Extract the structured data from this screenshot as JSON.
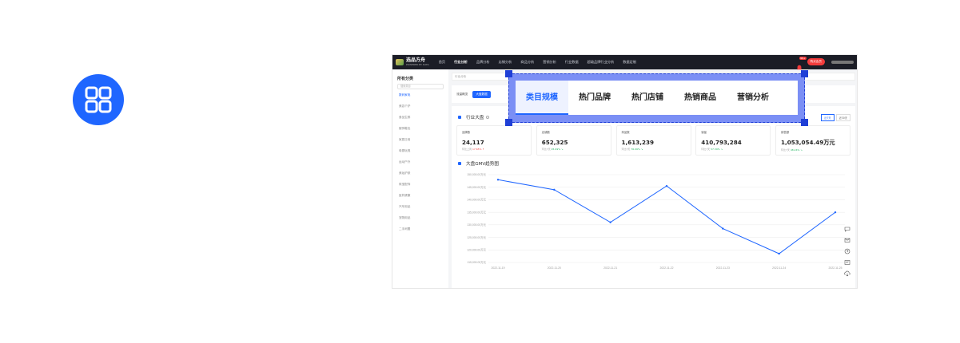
{
  "app": {
    "logo_title": "选品方舟",
    "logo_sub": "POWERED BY DATA"
  },
  "nav": {
    "items": [
      "首页",
      "行业分析",
      "品牌分析",
      "店铺分析",
      "商品分析",
      "营销分析",
      "行业数据",
      "超级品牌行业分析",
      "数据定制"
    ],
    "active_index": 1
  },
  "header": {
    "badge": "99+",
    "cta_label": "购买会员"
  },
  "sidebar": {
    "title": "所有分类",
    "search_placeholder": "搜索类目",
    "items": [
      "数码家电",
      "美容个护",
      "食品生鲜",
      "服饰鞋包",
      "家居日用",
      "母婴玩具",
      "运动户外",
      "美妆护肤",
      "珠宝配饰",
      "医药健康",
      "汽车用品",
      "宠物用品",
      "二手闲置"
    ]
  },
  "content": {
    "breadcrumb": "行业分析",
    "tabs": [
      "流量概览",
      "大盘数据"
    ],
    "active_tab": 1
  },
  "overlay_tabs": {
    "items": [
      "类目规模",
      "热门品牌",
      "热门店铺",
      "热销商品",
      "营销分析"
    ],
    "active_index": 0
  },
  "section_industry": {
    "title": "行业大盘",
    "ranges": [
      "近7天",
      "近30天"
    ]
  },
  "metrics": [
    {
      "label": "品牌数",
      "value": "24,117",
      "delta_prefix": "环比上周",
      "delta": "17.65%",
      "dir": "up"
    },
    {
      "label": "店铺数",
      "value": "652,325",
      "delta_prefix": "环比7天",
      "delta": "45.99%",
      "dir": "down"
    },
    {
      "label": "商品数",
      "value": "1,613,239",
      "delta_prefix": "环比7天",
      "delta": "76.06%",
      "dir": "down"
    },
    {
      "label": "销量",
      "value": "410,793,284",
      "delta_prefix": "环比7天",
      "delta": "57.39%",
      "dir": "down"
    },
    {
      "label": "销售额",
      "value": "1,053,054.49万元",
      "delta_prefix": "环比7天",
      "delta": "48.24%",
      "dir": "down"
    }
  ],
  "section_chart": {
    "title": "大盘GMV趋势图"
  },
  "colors": {
    "accent": "#1f66ff",
    "overlay": "#7b8ff5",
    "topbar": "#1b1d26",
    "danger": "#f23c3c"
  },
  "chart_data": {
    "type": "line",
    "title": "大盘GMV趋势图",
    "x": [
      "2022-11-19",
      "2022-11-20",
      "2022-11-21",
      "2022-11-22",
      "2022-11-23",
      "2022-11-24",
      "2022-11-25"
    ],
    "y_ticks": [
      "150,000.00万元",
      "145,000.00万元",
      "140,000.00万元",
      "135,000.00万元",
      "130,000.00万元",
      "125,000.00万元",
      "120,000.00万元",
      "115,000.00万元"
    ],
    "ylim": [
      115000,
      150000
    ],
    "series": [
      {
        "values": [
          148000,
          144000,
          131000,
          145500,
          128500,
          118500,
          135000
        ]
      }
    ],
    "grid": true
  }
}
